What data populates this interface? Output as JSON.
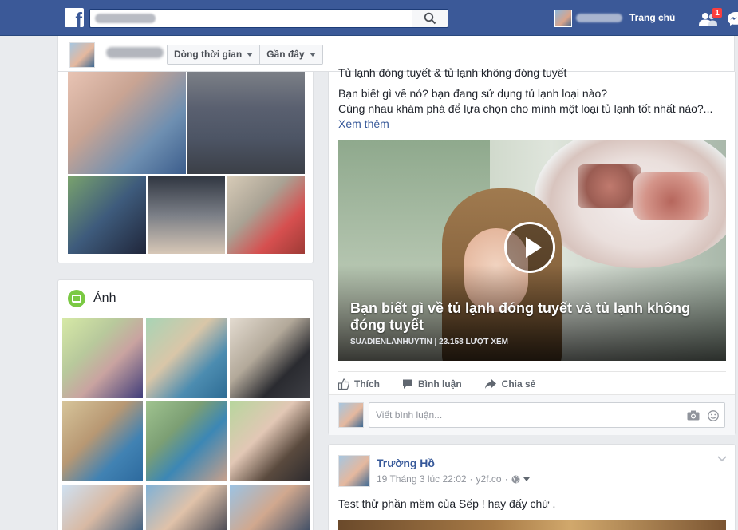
{
  "header": {
    "home_label": "Trang chủ",
    "friend_requests_count": "1"
  },
  "timeline_bar": {
    "timeline_label": "Dòng thời gian",
    "recent_label": "Gần đây"
  },
  "photos": {
    "title": "Ảnh"
  },
  "post1": {
    "line_top": "Tủ lạnh đóng tuyết & tủ lạnh không đóng tuyết",
    "line1": "Bạn biết gì về nó? bạn đang sử dụng tủ lạnh loại nào?",
    "line2": "Cùng nhau khám phá để lựa chọn cho mình một loại tủ lạnh tốt nhất nào?...",
    "see_more": "Xem thêm",
    "video_title": "Bạn biết gì về tủ lạnh đóng tuyết và tủ lạnh không đóng tuyết",
    "video_meta": "SUADIENLANHUYTIN | 23.158 LƯỢT XEM",
    "like_label": "Thích",
    "comment_label": "Bình luận",
    "share_label": "Chia sẻ",
    "comment_placeholder": "Viết bình luận..."
  },
  "post2": {
    "author": "Trường Hồ",
    "timestamp": "19 Tháng 3 lúc 22:02",
    "source": "y2f.co",
    "text": "Test thử phần mềm của Sếp ! hay đấy chứ ."
  },
  "colors": {
    "brand": "#3b5998",
    "link": "#365899",
    "background": "#e9ebee",
    "badge": "#fa3e3e"
  }
}
